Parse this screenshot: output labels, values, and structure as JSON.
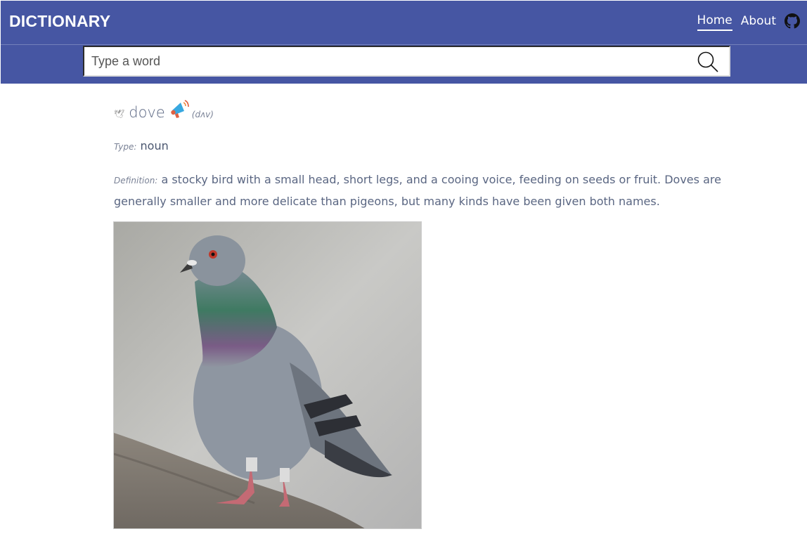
{
  "header": {
    "brand": "DICTIONARY",
    "nav": [
      {
        "label": "Home",
        "active": true
      },
      {
        "label": "About",
        "active": false
      }
    ],
    "github_icon": "github-icon",
    "bg_color": "#4656a3"
  },
  "search": {
    "placeholder": "Type a word",
    "value": "",
    "icon": "search-icon"
  },
  "entry": {
    "word": "dove",
    "phonetic": "(dʌv)",
    "type_label": "Type:",
    "type": "noun",
    "definition_label": "Definition:",
    "definition": "a stocky bird with a small head, short legs, and a cooing voice, feeding on seeds or fruit. Doves are generally smaller and more delicate than pigeons, but many kinds have been given both names."
  }
}
